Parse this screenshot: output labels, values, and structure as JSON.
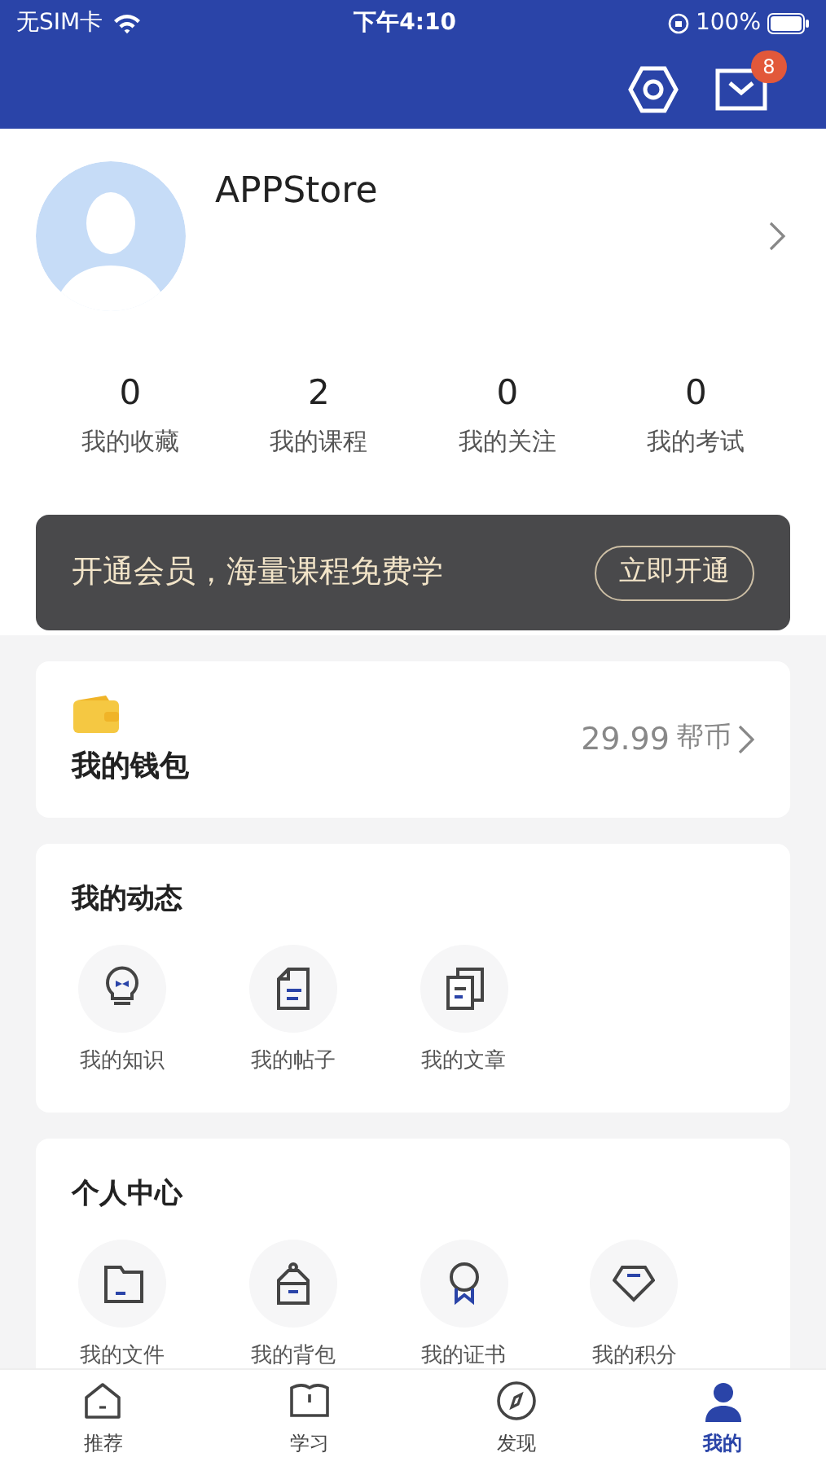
{
  "status_bar": {
    "carrier": "无SIM卡",
    "time": "下午4:10",
    "battery": "100%"
  },
  "header": {
    "message_count": "8"
  },
  "profile": {
    "name": "APPStore"
  },
  "stats": [
    {
      "value": "0",
      "label": "我的收藏"
    },
    {
      "value": "2",
      "label": "我的课程"
    },
    {
      "value": "0",
      "label": "我的关注"
    },
    {
      "value": "0",
      "label": "我的考试"
    }
  ],
  "vip_banner": {
    "text": "开通会员，海量课程免费学",
    "button": "立即开通"
  },
  "wallet": {
    "title": "我的钱包",
    "amount": "29.99",
    "unit": "帮币"
  },
  "sections": [
    {
      "title": "我的动态",
      "items": [
        {
          "kind": "bulb",
          "label": "我的知识"
        },
        {
          "kind": "doc",
          "label": "我的帖子"
        },
        {
          "kind": "docs",
          "label": "我的文章"
        }
      ]
    },
    {
      "title": "个人中心",
      "items": [
        {
          "kind": "folder",
          "label": "我的文件"
        },
        {
          "kind": "bag",
          "label": "我的背包"
        },
        {
          "kind": "medal",
          "label": "我的证书"
        },
        {
          "kind": "gem",
          "label": "我的积分"
        }
      ]
    }
  ],
  "tabs": [
    {
      "kind": "home",
      "label": "推荐",
      "selected": false
    },
    {
      "kind": "book",
      "label": "学习",
      "selected": false
    },
    {
      "kind": "compass",
      "label": "发现",
      "selected": false
    },
    {
      "kind": "person",
      "label": "我的",
      "selected": true
    }
  ]
}
